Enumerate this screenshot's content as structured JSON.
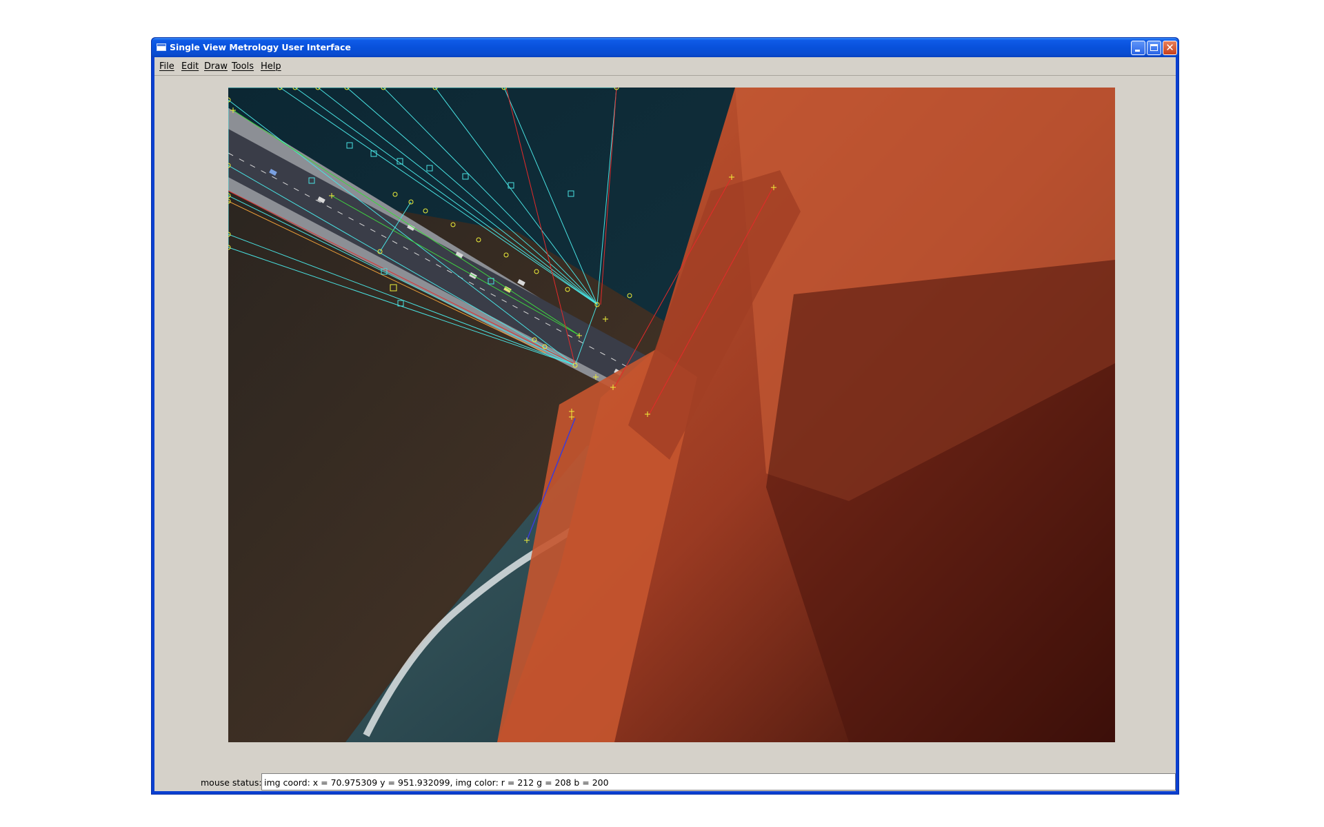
{
  "window": {
    "title": "Single View Metrology User Interface",
    "titlebar_color": "#0a4cd0"
  },
  "menu": {
    "items": [
      "File",
      "Edit",
      "Draw",
      "Tools",
      "Help"
    ]
  },
  "image": {
    "description_icon": "photo-canvas",
    "overlay_colors": {
      "cyan_lines": "#49e3e3",
      "green_lines": "#3fd63f",
      "yellow_markers": "#f1f13a",
      "orange_line": "#f2a33a",
      "red_lines": "#e52a2a",
      "blue_line": "#3b3bd8"
    }
  },
  "status": {
    "label": "mouse status:",
    "text": "img coord: x = 70.975309 y = 951.932099, img color: r = 212 g = 208 b = 200"
  }
}
